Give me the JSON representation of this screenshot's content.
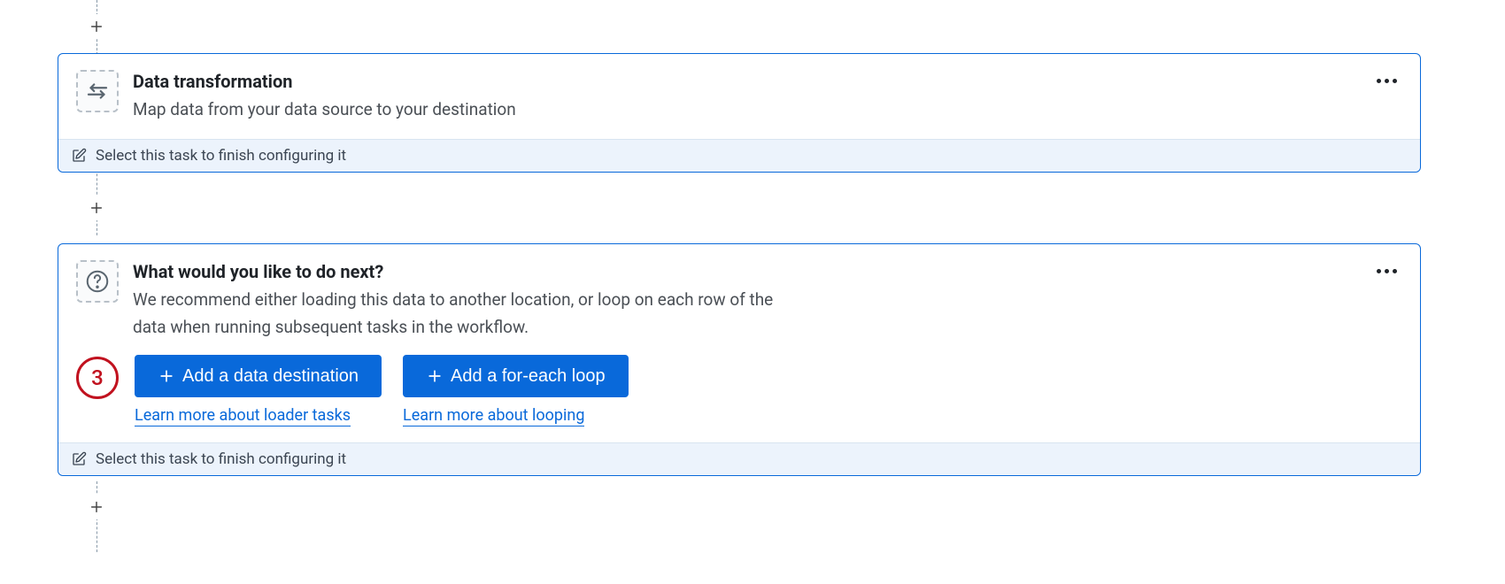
{
  "cards": {
    "transform": {
      "title": "Data transformation",
      "desc": "Map data from your data source to your destination",
      "footer": "Select this task to finish configuring it"
    },
    "next": {
      "title": "What would you like to do next?",
      "desc": "We recommend either loading this data to another location, or loop on each row of the data when running subsequent tasks in the workflow.",
      "footer": "Select this task to finish configuring it",
      "step_number": "3",
      "actions": {
        "destination": {
          "button": "Add a data destination",
          "link": "Learn more about loader tasks"
        },
        "loop": {
          "button": "Add a for-each loop",
          "link": "Learn more about looping"
        }
      }
    }
  }
}
